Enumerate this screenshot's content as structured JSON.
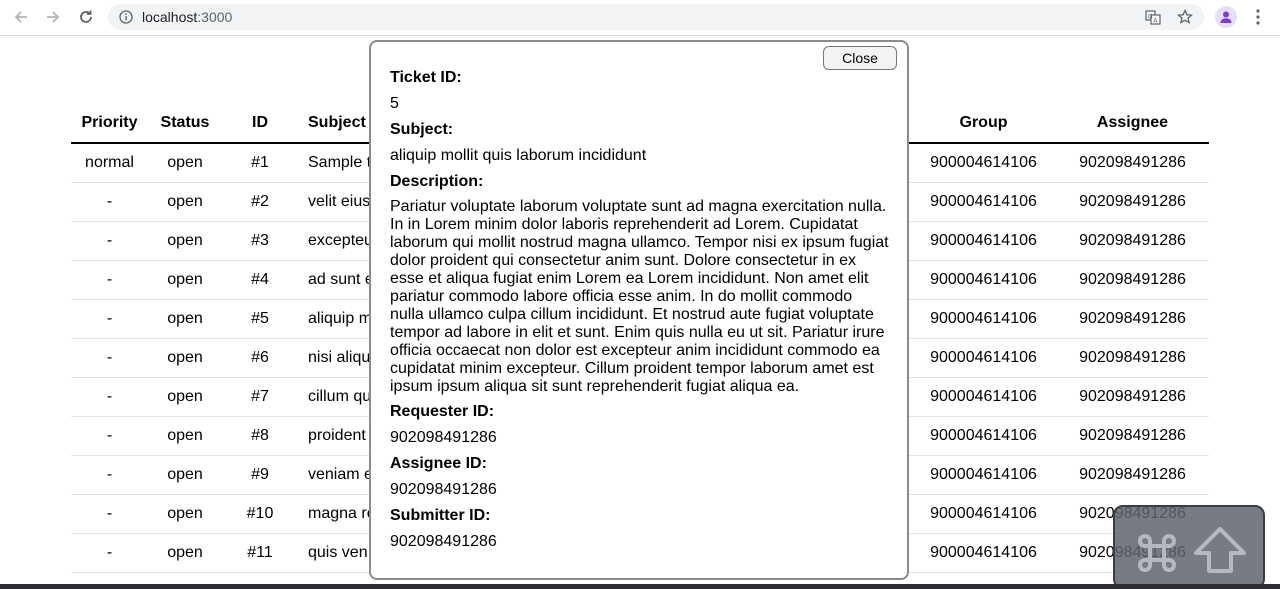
{
  "browser": {
    "url_host": "localhost",
    "url_port": ":3000",
    "icons": [
      "back-arrow-icon",
      "forward-arrow-icon",
      "reload-icon",
      "info-icon",
      "translate-icon",
      "star-icon",
      "profile-avatar-icon",
      "more-menu-icon"
    ]
  },
  "table": {
    "headers": {
      "priority": "Priority",
      "status": "Status",
      "id": "ID",
      "subject": "Subject",
      "group": "Group",
      "assignee": "Assignee"
    },
    "rows": [
      {
        "priority": "normal",
        "status": "open",
        "id": "#1",
        "subject": "Sample t",
        "group": "900004614106",
        "assignee": "902098491286"
      },
      {
        "priority": "-",
        "status": "open",
        "id": "#2",
        "subject": "velit eius",
        "group": "900004614106",
        "assignee": "902098491286"
      },
      {
        "priority": "-",
        "status": "open",
        "id": "#3",
        "subject": "excepteu",
        "group": "900004614106",
        "assignee": "902098491286"
      },
      {
        "priority": "-",
        "status": "open",
        "id": "#4",
        "subject": "ad sunt e",
        "group": "900004614106",
        "assignee": "902098491286"
      },
      {
        "priority": "-",
        "status": "open",
        "id": "#5",
        "subject": "aliquip m",
        "group": "900004614106",
        "assignee": "902098491286"
      },
      {
        "priority": "-",
        "status": "open",
        "id": "#6",
        "subject": "nisi aliqu",
        "group": "900004614106",
        "assignee": "902098491286"
      },
      {
        "priority": "-",
        "status": "open",
        "id": "#7",
        "subject": "cillum qu",
        "group": "900004614106",
        "assignee": "902098491286"
      },
      {
        "priority": "-",
        "status": "open",
        "id": "#8",
        "subject": "proident",
        "group": "900004614106",
        "assignee": "902098491286"
      },
      {
        "priority": "-",
        "status": "open",
        "id": "#9",
        "subject": "veniam e",
        "group": "900004614106",
        "assignee": "902098491286"
      },
      {
        "priority": "-",
        "status": "open",
        "id": "#10",
        "subject": "magna re",
        "group": "900004614106",
        "assignee": "902098491286"
      },
      {
        "priority": "-",
        "status": "open",
        "id": "#11",
        "subject": "quis ven",
        "group": "900004614106",
        "assignee": "902098491286"
      }
    ]
  },
  "modal": {
    "close_label": "Close",
    "ticket_id_label": "Ticket ID:",
    "ticket_id": "5",
    "subject_label": "Subject:",
    "subject": "aliquip mollit quis laborum incididunt",
    "description_label": "Description:",
    "description": "Pariatur voluptate laborum voluptate sunt ad magna exercitation nulla. In in Lorem minim dolor laboris reprehenderit ad Lorem. Cupidatat laborum qui mollit nostrud magna ullamco. Tempor nisi ex ipsum fugiat dolor proident qui consectetur anim sunt. Dolore consectetur in ex esse et aliqua fugiat enim Lorem ea Lorem incididunt. Non amet elit pariatur commodo labore officia esse anim. In do mollit commodo nulla ullamco culpa cillum incididunt. Et nostrud aute fugiat voluptate tempor ad labore in elit et sunt. Enim quis nulla eu ut sit. Pariatur irure officia occaecat non dolor est excepteur anim incididunt commodo ea cupidatat minim excepteur. Cillum proident tempor laborum amet est ipsum ipsum aliqua sit sunt reprehenderit fugiat aliqua ea.",
    "requester_id_label": "Requester ID:",
    "requester_id": "902098491286",
    "assignee_id_label": "Assignee ID:",
    "assignee_id": "902098491286",
    "submitter_id_label": "Submitter ID:",
    "submitter_id": "902098491286"
  },
  "overlay": {
    "icons": [
      "command-key-icon",
      "shift-key-icon"
    ]
  }
}
